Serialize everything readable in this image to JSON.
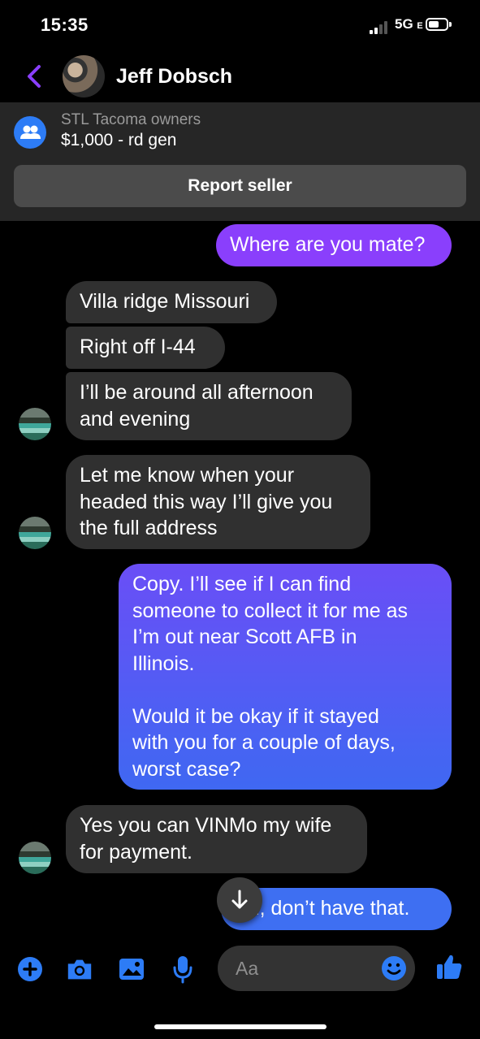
{
  "status_bar": {
    "time": "15:35",
    "network": "5G",
    "network_suffix": "E"
  },
  "header": {
    "contact_name": "Jeff Dobsch"
  },
  "listing": {
    "group_name": "STL Tacoma owners",
    "title": "$1,000 - rd gen",
    "report_label": "Report seller"
  },
  "messages": [
    {
      "from": "me",
      "text": "Where are you mate?"
    },
    {
      "from": "seller",
      "text": "Villa ridge Missouri"
    },
    {
      "from": "seller",
      "text": "Right off I-44"
    },
    {
      "from": "seller",
      "text": "I’ll be around all afternoon\nand evening"
    },
    {
      "from": "seller",
      "text": "Let me know when your\nheaded this way I’ll give you\nthe full address"
    },
    {
      "from": "me",
      "text": "Copy. I’ll see if I can find\nsomeone to collect it for me as\nI’m out near Scott AFB in\nIllinois.\n\nWould it be okay if it stayed\nwith you for a couple of days,\nworst case?"
    },
    {
      "from": "seller",
      "text": "Yes you can VINMo my wife\nfor payment."
    },
    {
      "from": "me",
      "text": "Ah, don’t have that."
    }
  ],
  "composer": {
    "placeholder": "Aa"
  },
  "icons": {
    "back": "chevron-left-icon",
    "group": "group-icon",
    "add": "plus-icon",
    "camera": "camera-icon",
    "gallery": "image-icon",
    "mic": "mic-icon",
    "emoji": "emoji-icon",
    "like": "thumbs-up-icon",
    "jump": "arrow-down-icon"
  },
  "colors": {
    "accent": "#8a3ffc",
    "blue": "#2d7cf6",
    "incoming": "#303030"
  }
}
